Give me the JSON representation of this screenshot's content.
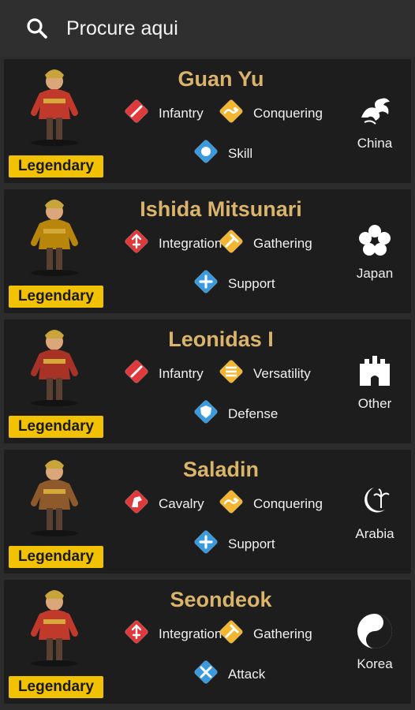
{
  "search": {
    "placeholder": "Procure aqui"
  },
  "commanders": [
    {
      "name": "Guan Yu",
      "rarity": "Legendary",
      "civilization": "China",
      "civ_icon": "dragon-icon",
      "talents": [
        {
          "label": "Infantry",
          "icon": "infantry-icon",
          "color": "#e0393b"
        },
        {
          "label": "Conquering",
          "icon": "conquering-icon",
          "color": "#f2b632"
        },
        {
          "label": "Skill",
          "icon": "skill-icon",
          "color": "#3a9ae0"
        }
      ]
    },
    {
      "name": "Ishida Mitsunari",
      "rarity": "Legendary",
      "civilization": "Japan",
      "civ_icon": "sakura-icon",
      "talents": [
        {
          "label": "Integration",
          "icon": "integration-icon",
          "color": "#e0393b"
        },
        {
          "label": "Gathering",
          "icon": "gathering-icon",
          "color": "#f2b632"
        },
        {
          "label": "Support",
          "icon": "support-icon",
          "color": "#3a9ae0"
        }
      ]
    },
    {
      "name": "Leonidas I",
      "rarity": "Legendary",
      "civilization": "Other",
      "civ_icon": "castle-icon",
      "talents": [
        {
          "label": "Infantry",
          "icon": "infantry-icon",
          "color": "#e0393b"
        },
        {
          "label": "Versatility",
          "icon": "versatility-icon",
          "color": "#f2b632"
        },
        {
          "label": "Defense",
          "icon": "defense-icon",
          "color": "#3a9ae0"
        }
      ]
    },
    {
      "name": "Saladin",
      "rarity": "Legendary",
      "civilization": "Arabia",
      "civ_icon": "crescent-palm-icon",
      "talents": [
        {
          "label": "Cavalry",
          "icon": "cavalry-icon",
          "color": "#e0393b"
        },
        {
          "label": "Conquering",
          "icon": "conquering-icon",
          "color": "#f2b632"
        },
        {
          "label": "Support",
          "icon": "support-icon",
          "color": "#3a9ae0"
        }
      ]
    },
    {
      "name": "Seondeok",
      "rarity": "Legendary",
      "civilization": "Korea",
      "civ_icon": "taeguk-icon",
      "talents": [
        {
          "label": "Integration",
          "icon": "integration-icon",
          "color": "#e0393b"
        },
        {
          "label": "Gathering",
          "icon": "gathering-icon",
          "color": "#f2b632"
        },
        {
          "label": "Attack",
          "icon": "attack-icon",
          "color": "#3a9ae0"
        }
      ]
    }
  ]
}
